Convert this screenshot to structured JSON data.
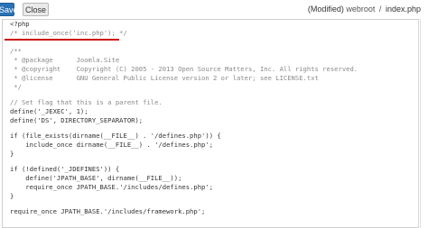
{
  "toolbar": {
    "save_label": "Save",
    "close_label": "Close"
  },
  "file_info": {
    "status": "(Modified)",
    "folder": "webroot",
    "separator": "/",
    "filename": "index.php"
  },
  "code": {
    "line_1": "<?php",
    "line_2": "/* include_once('inc.php'); */",
    "line_4": "/**",
    "line_5": " * @package      Joomla.Site",
    "line_6": " * @copyright    Copyright (C) 2005 - 2013 Open Source Matters, Inc. All rights reserved.",
    "line_7": " * @license      GNU General Public License version 2 or later; see LICENSE.txt",
    "line_8": " */",
    "line_10": "// Set flag that this is a parent file.",
    "line_11": "define('_JEXEC', 1);",
    "line_12": "define('DS', DIRECTORY_SEPARATOR);",
    "line_14": "if (file_exists(dirname(__FILE__) . '/defines.php')) {",
    "line_15": "    include_once dirname(__FILE__) . '/defines.php';",
    "line_16": "}",
    "line_18": "if (!defined('_JDEFINES')) {",
    "line_19": "    define('JPATH_BASE', dirname(__FILE__));",
    "line_20": "    require_once JPATH_BASE.'/includes/defines.php';",
    "line_21": "}",
    "line_23": "require_once JPATH_BASE.'/includes/framework.php';"
  },
  "colors": {
    "save_button": "#2a72b5",
    "highlight_underline": "#cc1111"
  }
}
